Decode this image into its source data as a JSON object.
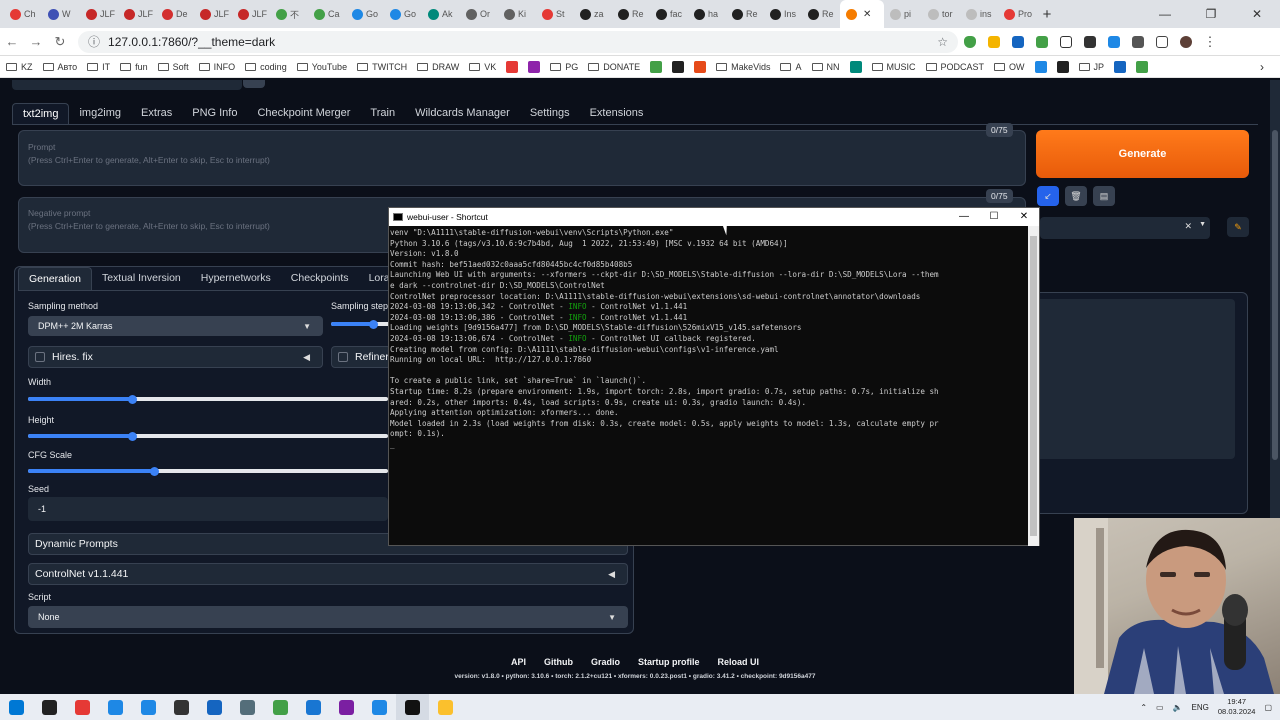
{
  "browser": {
    "tabs": [
      {
        "label": "Ch",
        "color": "#e53935"
      },
      {
        "label": "W",
        "color": "#3f51b5"
      },
      {
        "label": "JLF",
        "color": "#c62828"
      },
      {
        "label": "JLF",
        "color": "#c62828"
      },
      {
        "label": "De",
        "color": "#d32f2f"
      },
      {
        "label": "JLF",
        "color": "#c62828"
      },
      {
        "label": "JLF",
        "color": "#c62828"
      },
      {
        "label": "不",
        "color": "#43a047"
      },
      {
        "label": "Ca",
        "color": "#43a047"
      },
      {
        "label": "Go",
        "color": "#1e88e5"
      },
      {
        "label": "Go",
        "color": "#1e88e5"
      },
      {
        "label": "Ak",
        "color": "#00897b"
      },
      {
        "label": "Or",
        "color": "#616161"
      },
      {
        "label": "Ki",
        "color": "#616161"
      },
      {
        "label": "St",
        "color": "#e53935"
      },
      {
        "label": "za",
        "color": "#212121"
      },
      {
        "label": "Re",
        "color": "#212121"
      },
      {
        "label": "fac",
        "color": "#212121"
      },
      {
        "label": "ha",
        "color": "#212121"
      },
      {
        "label": "Re",
        "color": "#212121"
      },
      {
        "label": "Ins",
        "color": "#212121"
      },
      {
        "label": "Re",
        "color": "#212121"
      },
      {
        "label": "",
        "color": "#f57c00",
        "active": true
      },
      {
        "label": "pi",
        "color": "#bdbdbd"
      },
      {
        "label": "tor",
        "color": "#bdbdbd"
      },
      {
        "label": "ins",
        "color": "#bdbdbd"
      },
      {
        "label": "Pro",
        "color": "#e53935"
      }
    ],
    "url": "127.0.0.1:7860/?__theme=dark",
    "bookmarks": [
      {
        "label": "KZ",
        "type": "folder"
      },
      {
        "label": "Авто",
        "type": "folder"
      },
      {
        "label": "IT",
        "type": "folder"
      },
      {
        "label": "fun",
        "type": "folder"
      },
      {
        "label": "Soft",
        "type": "folder"
      },
      {
        "label": "INFO",
        "type": "folder"
      },
      {
        "label": "coding",
        "type": "folder"
      },
      {
        "label": "YouTube",
        "type": "folder"
      },
      {
        "label": "TWITCH",
        "type": "folder"
      },
      {
        "label": "DRAW",
        "type": "folder"
      },
      {
        "label": "VK",
        "type": "folder"
      },
      {
        "label": "",
        "type": "icon",
        "color": "#e53935"
      },
      {
        "label": "",
        "type": "icon",
        "color": "#8e24aa"
      },
      {
        "label": "PG",
        "type": "folder"
      },
      {
        "label": "DONATE",
        "type": "folder"
      },
      {
        "label": "",
        "type": "icon",
        "color": "#43a047"
      },
      {
        "label": "",
        "type": "icon",
        "color": "#212121"
      },
      {
        "label": "",
        "type": "icon",
        "color": "#e64a19"
      },
      {
        "label": "MakeVids",
        "type": "folder"
      },
      {
        "label": "A",
        "type": "folder"
      },
      {
        "label": "NN",
        "type": "folder"
      },
      {
        "label": "",
        "type": "icon",
        "color": "#00897b"
      },
      {
        "label": "MUSIC",
        "type": "folder"
      },
      {
        "label": "PODCAST",
        "type": "folder"
      },
      {
        "label": "OW",
        "type": "folder"
      },
      {
        "label": "",
        "type": "icon",
        "color": "#1e88e5"
      },
      {
        "label": "",
        "type": "icon",
        "color": "#212121"
      },
      {
        "label": "JP",
        "type": "folder"
      },
      {
        "label": "",
        "type": "icon",
        "color": "#1565c0"
      },
      {
        "label": "",
        "type": "icon",
        "color": "#43a047"
      }
    ]
  },
  "app": {
    "tabs": [
      "txt2img",
      "img2img",
      "Extras",
      "PNG Info",
      "Checkpoint Merger",
      "Train",
      "Wildcards Manager",
      "Settings",
      "Extensions"
    ],
    "prompt": {
      "label": "Prompt",
      "placeholder": "(Press Ctrl+Enter to generate, Alt+Enter to skip, Esc to interrupt)",
      "counter": "0/75"
    },
    "negative_prompt": {
      "label": "Negative prompt",
      "placeholder": "(Press Ctrl+Enter to generate, Alt+Enter to skip, Esc to interrupt)",
      "counter": "0/75"
    },
    "generate_label": "Generate",
    "subtabs": [
      "Generation",
      "Textual Inversion",
      "Hypernetworks",
      "Checkpoints",
      "Lora"
    ],
    "sampling_method": {
      "label": "Sampling method",
      "value": "DPM++ 2M Karras"
    },
    "sampling_steps_label": "Sampling steps",
    "hires_fix_label": "Hires. fix",
    "refiner_label": "Refiner",
    "width": {
      "label": "Width",
      "fraction": 0.29
    },
    "height": {
      "label": "Height",
      "fraction": 0.29
    },
    "cfg": {
      "label": "CFG Scale",
      "fraction": 0.35
    },
    "steps_fraction": 0.7,
    "seed": {
      "label": "Seed",
      "value": "-1"
    },
    "dynamic_prompts_label": "Dynamic Prompts",
    "controlnet_label": "ControlNet v1.1.441",
    "script": {
      "label": "Script",
      "value": "None"
    },
    "footer_links": [
      "API",
      "Github",
      "Gradio",
      "Startup profile",
      "Reload UI"
    ],
    "version_line": "version: v1.8.0  •  python: 3.10.6  •  torch: 2.1.2+cu121  •  xformers: 0.0.23.post1  •  gradio: 3.41.2  •  checkpoint: 9d9156a477"
  },
  "console": {
    "title": "webui-user - Shortcut",
    "lines": [
      {
        "text": "venv \"D:\\A1111\\stable-diffusion-webui\\venv\\Scripts\\Python.exe\""
      },
      {
        "text": "Python 3.10.6 (tags/v3.10.6:9c7b4bd, Aug  1 2022, 21:53:49) [MSC v.1932 64 bit (AMD64)]"
      },
      {
        "text": "Version: v1.8.0"
      },
      {
        "text": "Commit hash: bef51aed032c0aaa5cfd80445bc4cf0d85b408b5"
      },
      {
        "text": "Launching Web UI with arguments: --xformers --ckpt-dir D:\\SD_MODELS\\Stable-diffusion --lora-dir D:\\SD_MODELS\\Lora --them"
      },
      {
        "text": "e dark --controlnet-dir D:\\SD_MODELS\\ControlNet"
      },
      {
        "text": "ControlNet preprocessor location: D:\\A1111\\stable-diffusion-webui\\extensions\\sd-webui-controlnet\\annotator\\downloads"
      },
      {
        "pre": "2024-03-08 19:13:06,342 - ControlNet - ",
        "level": "INFO",
        "post": " - ControlNet v1.1.441"
      },
      {
        "pre": "2024-03-08 19:13:06,386 - ControlNet - ",
        "level": "INFO",
        "post": " - ControlNet v1.1.441"
      },
      {
        "text": "Loading weights [9d9156a477] from D:\\SD_MODELS\\Stable-diffusion\\526mixV15_v145.safetensors"
      },
      {
        "pre": "2024-03-08 19:13:06,674 - ControlNet - ",
        "level": "INFO",
        "post": " - ControlNet UI callback registered."
      },
      {
        "text": "Creating model from config: D:\\A1111\\stable-diffusion-webui\\configs\\v1-inference.yaml"
      },
      {
        "text": "Running on local URL:  http://127.0.0.1:7860"
      },
      {
        "text": ""
      },
      {
        "text": "To create a public link, set `share=True` in `launch()`."
      },
      {
        "text": "Startup time: 8.2s (prepare environment: 1.9s, import torch: 2.8s, import gradio: 0.7s, setup paths: 0.7s, initialize sh"
      },
      {
        "text": "ared: 0.2s, other imports: 0.4s, load scripts: 0.9s, create ui: 0.3s, gradio launch: 0.4s)."
      },
      {
        "text": "Applying attention optimization: xformers... done."
      },
      {
        "text": "Model loaded in 2.3s (load weights from disk: 0.3s, create model: 0.5s, apply weights to model: 1.3s, calculate empty pr"
      },
      {
        "text": "ompt: 0.1s)."
      },
      {
        "text": "_"
      }
    ]
  },
  "taskbar": {
    "apps": [
      {
        "name": "start-icon",
        "color": "#0078d4"
      },
      {
        "name": "search-icon",
        "color": "#222"
      },
      {
        "name": "chrome-icon",
        "color": "#e53935"
      },
      {
        "name": "app-icon",
        "color": "#1e88e5"
      },
      {
        "name": "calculator-icon",
        "color": "#1e88e5"
      },
      {
        "name": "obs-icon",
        "color": "#333"
      },
      {
        "name": "app-icon",
        "color": "#1565c0"
      },
      {
        "name": "app-icon",
        "color": "#546e7a"
      },
      {
        "name": "app-icon",
        "color": "#43a047"
      },
      {
        "name": "app-icon",
        "color": "#1976d2"
      },
      {
        "name": "onenote-icon",
        "color": "#7b1fa2"
      },
      {
        "name": "app-icon",
        "color": "#1e88e5"
      },
      {
        "name": "terminal-icon",
        "color": "#111"
      },
      {
        "name": "folder-icon",
        "color": "#fbc02d"
      }
    ],
    "lang": "ENG",
    "time": "19:47",
    "date": "08.03.2024"
  }
}
